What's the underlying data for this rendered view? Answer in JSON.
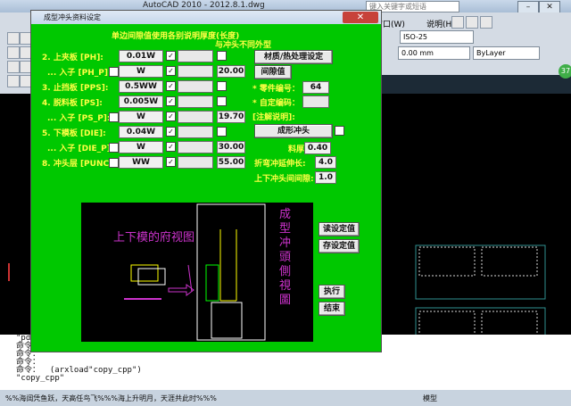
{
  "cad": {
    "title": "AutoCAD 2010 - 2012.8.1.dwg",
    "search_placeholder": "键入关键字或短语",
    "menu_window": "窗口(W)",
    "menu_help": "说明(H)",
    "dimstyle": "ISO-25",
    "lineweight": "0.00 mm",
    "linetype": "ByLayer",
    "notify_count": "37",
    "command_lines": [
      "\"pdia",
      "命令：",
      "命令：",
      "命令：",
      "命令：  (arxload\"copy_cpp\")",
      "\"copy_cpp\""
    ],
    "status_text": "%%海阔凭鱼跃，天高任鸟飞%%%海上升明月，天涯共此时%%%",
    "status_model": "模型"
  },
  "dialog": {
    "title": "成型冲头资料设定",
    "close_label": "✕",
    "header_line1": "单边间隙值使用各别说明厚度(长度)",
    "header_line2": "与冲头不同外型",
    "rows": [
      {
        "label": "2.  上夹板 [PH]:",
        "value": "0.01W",
        "checked": true
      },
      {
        "label": "... 入子 [PH_P]:",
        "value": "W",
        "checked": true,
        "extra": "20.00"
      },
      {
        "label": "3.  止挡板 [PPS]:",
        "value": "0.5WW",
        "checked": true
      },
      {
        "label": "4.  脱料板 [PS]:",
        "value": "0.005W",
        "checked": true
      },
      {
        "label": "... 入子 [PS_P]:",
        "value": "W",
        "checked": true,
        "extra": "19.70"
      },
      {
        "label": "5.  下模板 [DIE]:",
        "value": "0.04W",
        "checked": true
      },
      {
        "label": "... 入子 [DIE_P]:",
        "value": "W",
        "checked": true,
        "extra": "30.00"
      },
      {
        "label": "8.  冲头层 [PUNCH]:",
        "value": "WW",
        "checked": true,
        "extra": "55.00"
      }
    ],
    "material_button": "材质/热处理设定",
    "clearance_button": "间隙值",
    "part_no_label": "* 零件编号：",
    "part_no_value": "64",
    "custom_no_label": "* 自定编码：",
    "custom_no_value": "",
    "note_label": "[注解说明]:",
    "forming_punch_button": "成形冲头",
    "thickness_label": "料厚:",
    "thickness_value": "0.40",
    "bend_length_label": "折弯冲延伸长:",
    "bend_length_value": "4.0",
    "punch_gap_label": "上下冲头间间隙:",
    "punch_gap_value": "1.0",
    "read_button": "读设定值",
    "save_button": "存设定值",
    "execute_button": "执行",
    "end_button": "结束",
    "preview_caption": "上下模的府视图",
    "preview_side_text": "成型冲頭側視圖"
  },
  "colors": {
    "dialog_bg": "#00c800",
    "label_yellow": "#ffff44",
    "preview_magenta": "#cc33cc"
  }
}
